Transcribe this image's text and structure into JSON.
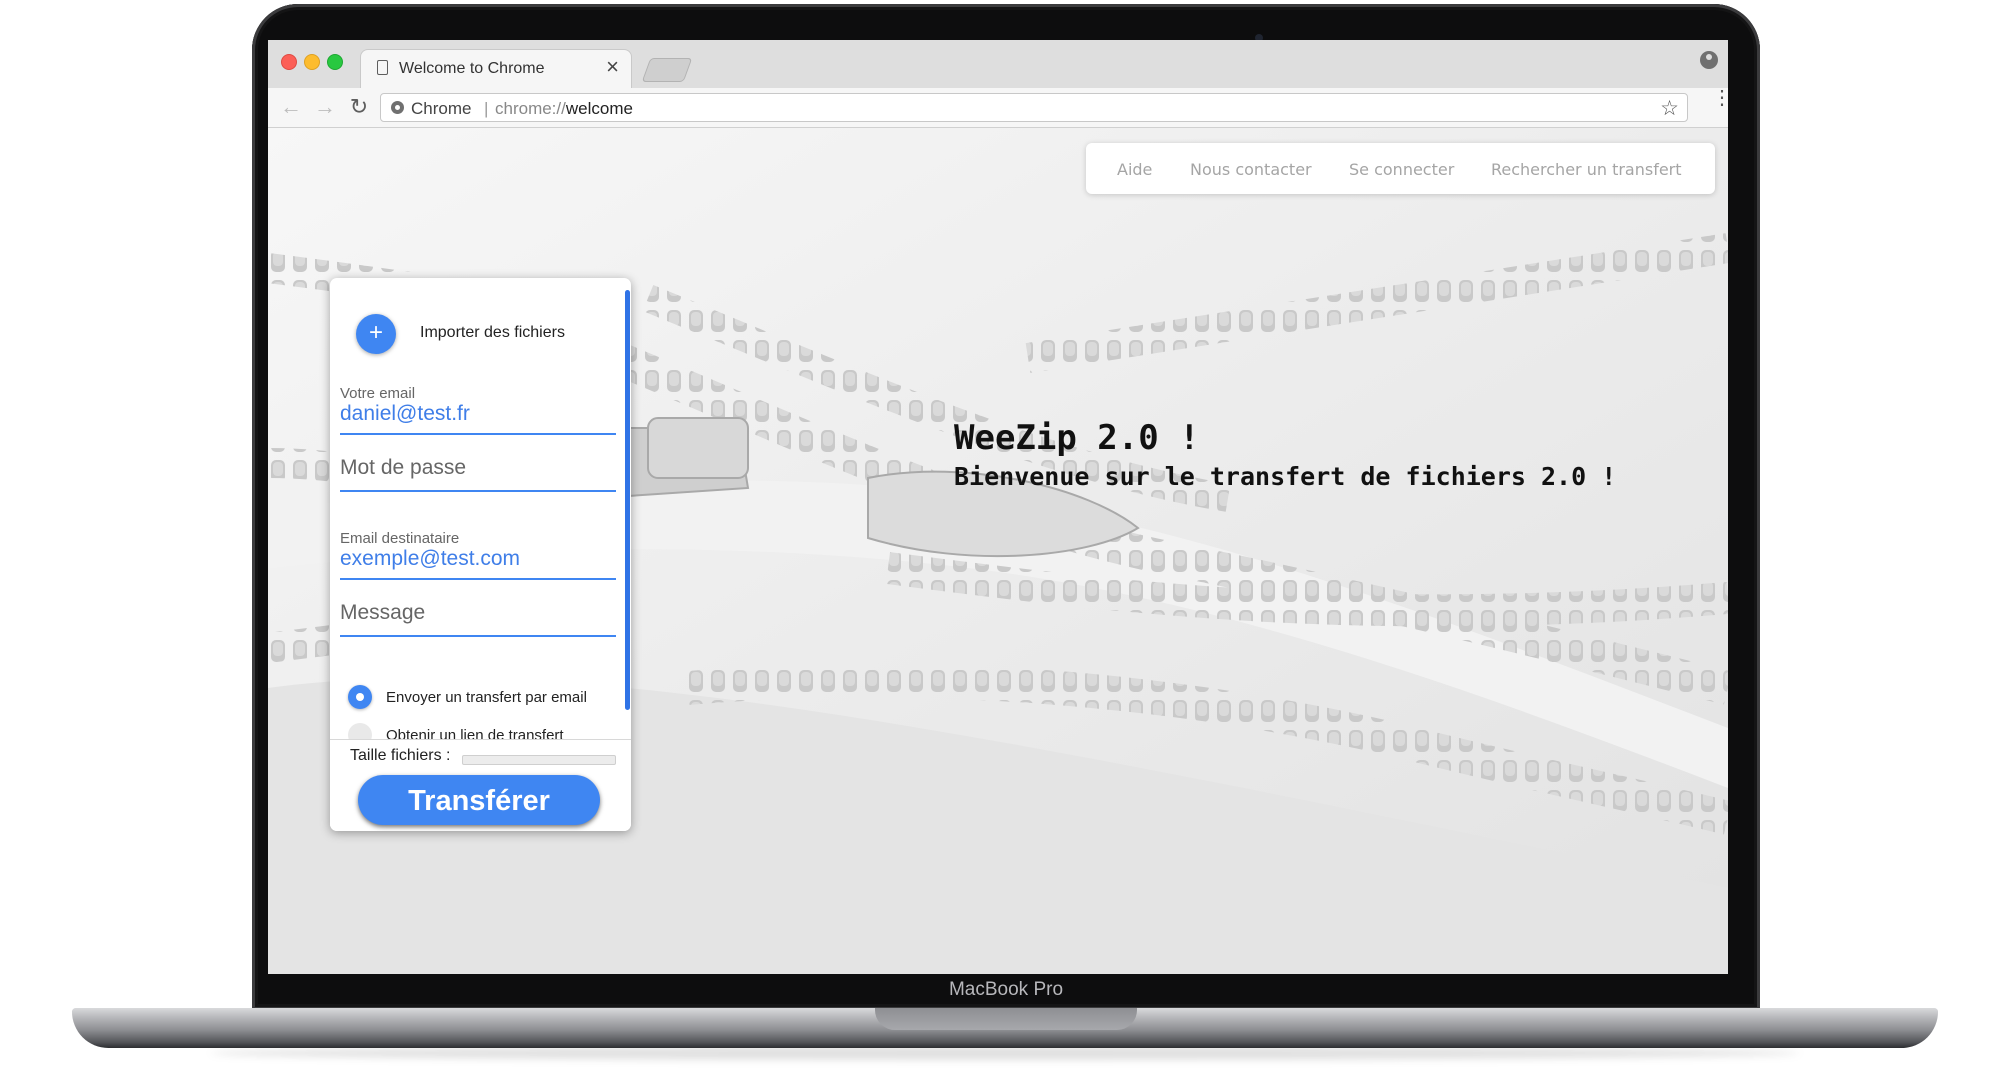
{
  "device": {
    "label": "MacBook Pro"
  },
  "browser": {
    "tab": {
      "title": "Welcome to Chrome",
      "close_glyph": "×"
    },
    "nav": {
      "back_glyph": "←",
      "forward_glyph": "→",
      "reload_glyph": "↻"
    },
    "omnibox": {
      "chip": "Chrome",
      "separator": "|",
      "scheme": "chrome://",
      "host": "welcome"
    },
    "star_glyph": "☆",
    "menu_glyph": "⋮"
  },
  "topnav": {
    "items": [
      {
        "label": "Aide"
      },
      {
        "label": "Nous contacter"
      },
      {
        "label": "Se connecter"
      },
      {
        "label": "Rechercher un transfert"
      }
    ]
  },
  "hero": {
    "title": "WeeZip 2.0 !",
    "subtitle": "Bienvenue sur le transfert de fichiers 2.0 !"
  },
  "upload_form": {
    "import": {
      "glyph": "+",
      "label": "Importer des fichiers"
    },
    "email": {
      "label": "Votre email",
      "value": "daniel@test.fr"
    },
    "password": {
      "placeholder": "Mot de passe"
    },
    "recipient": {
      "label": "Email destinataire",
      "value": "exemple@test.com"
    },
    "message": {
      "placeholder": "Message"
    },
    "options": [
      {
        "label": "Envoyer un transfert par email",
        "selected": true
      },
      {
        "label": "Obtenir un lien de transfert",
        "selected": false
      }
    ],
    "size": {
      "label": "Taille fichiers :",
      "progress": 0
    },
    "submit_label": "Transférer"
  },
  "colors": {
    "accent": "#3f86f2",
    "input_value": "#3f7ee8",
    "nav_text": "#a5a5a5"
  }
}
